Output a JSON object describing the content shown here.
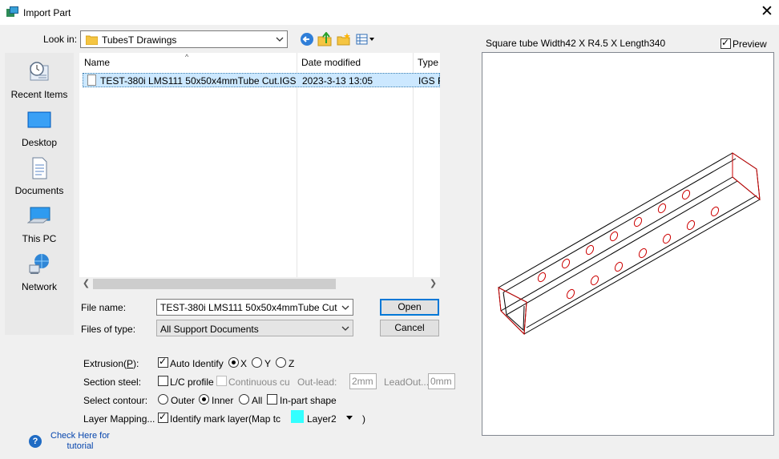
{
  "window": {
    "title": "Import Part",
    "close_glyph": "✕"
  },
  "lookin": {
    "label": "Look in:",
    "value": "TubesT Drawings"
  },
  "toolbar": {
    "icons": [
      "back-icon",
      "up-folder-icon",
      "new-folder-icon",
      "view-menu-icon"
    ]
  },
  "places": [
    {
      "label": "Recent Items",
      "icon": "recent-items-icon"
    },
    {
      "label": "Desktop",
      "icon": "desktop-icon"
    },
    {
      "label": "Documents",
      "icon": "documents-icon"
    },
    {
      "label": "This PC",
      "icon": "this-pc-icon"
    },
    {
      "label": "Network",
      "icon": "network-icon"
    }
  ],
  "filelist": {
    "columns": [
      "Name",
      "Date modified",
      "Type"
    ],
    "rows": [
      {
        "name": "TEST-380i LMS111 50x50x4mmTube Cut.IGS",
        "date": "2023-3-13 13:05",
        "type": "IGS Fi"
      }
    ]
  },
  "filename": {
    "label": "File name:",
    "value": "TEST-380i LMS111 50x50x4mmTube Cut"
  },
  "filetype": {
    "label": "Files of type:",
    "value": "All Support Documents"
  },
  "buttons": {
    "open": "Open",
    "cancel": "Cancel"
  },
  "options": {
    "extrusion": {
      "label": "Extrusion(P):",
      "auto_identify": "Auto Identify",
      "auto_identify_checked": true,
      "axes": [
        "X",
        "Y",
        "Z"
      ],
      "selected": "X"
    },
    "section_steel": {
      "label": "Section steel:",
      "lc_profile": "L/C profile",
      "continuous": "Continuous cu",
      "outlead_label": "Out-lead:",
      "outlead_value": "2mm",
      "leadout_label": "LeadOut...",
      "leadout_value": "0mm"
    },
    "select_contour": {
      "label": "Select contour:",
      "choices": [
        "Outer",
        "Inner",
        "All"
      ],
      "selected": "Inner",
      "inpart": "In-part shape"
    },
    "layer_mapping": {
      "label": "Layer Mapping...",
      "identify": "Identify mark layer(Map tc",
      "identify_checked": true,
      "layer_color": "#33ffff",
      "layer_name": "Layer2",
      "close_paren": ")"
    }
  },
  "preview": {
    "caption": "Square tube Width42 X R4.5 X Length340",
    "label": "Preview",
    "checked": true,
    "outline_color": "#000000",
    "hole_color": "#cc0000"
  },
  "help": {
    "link": "Check Here for tutorial",
    "icon": "help-icon"
  }
}
